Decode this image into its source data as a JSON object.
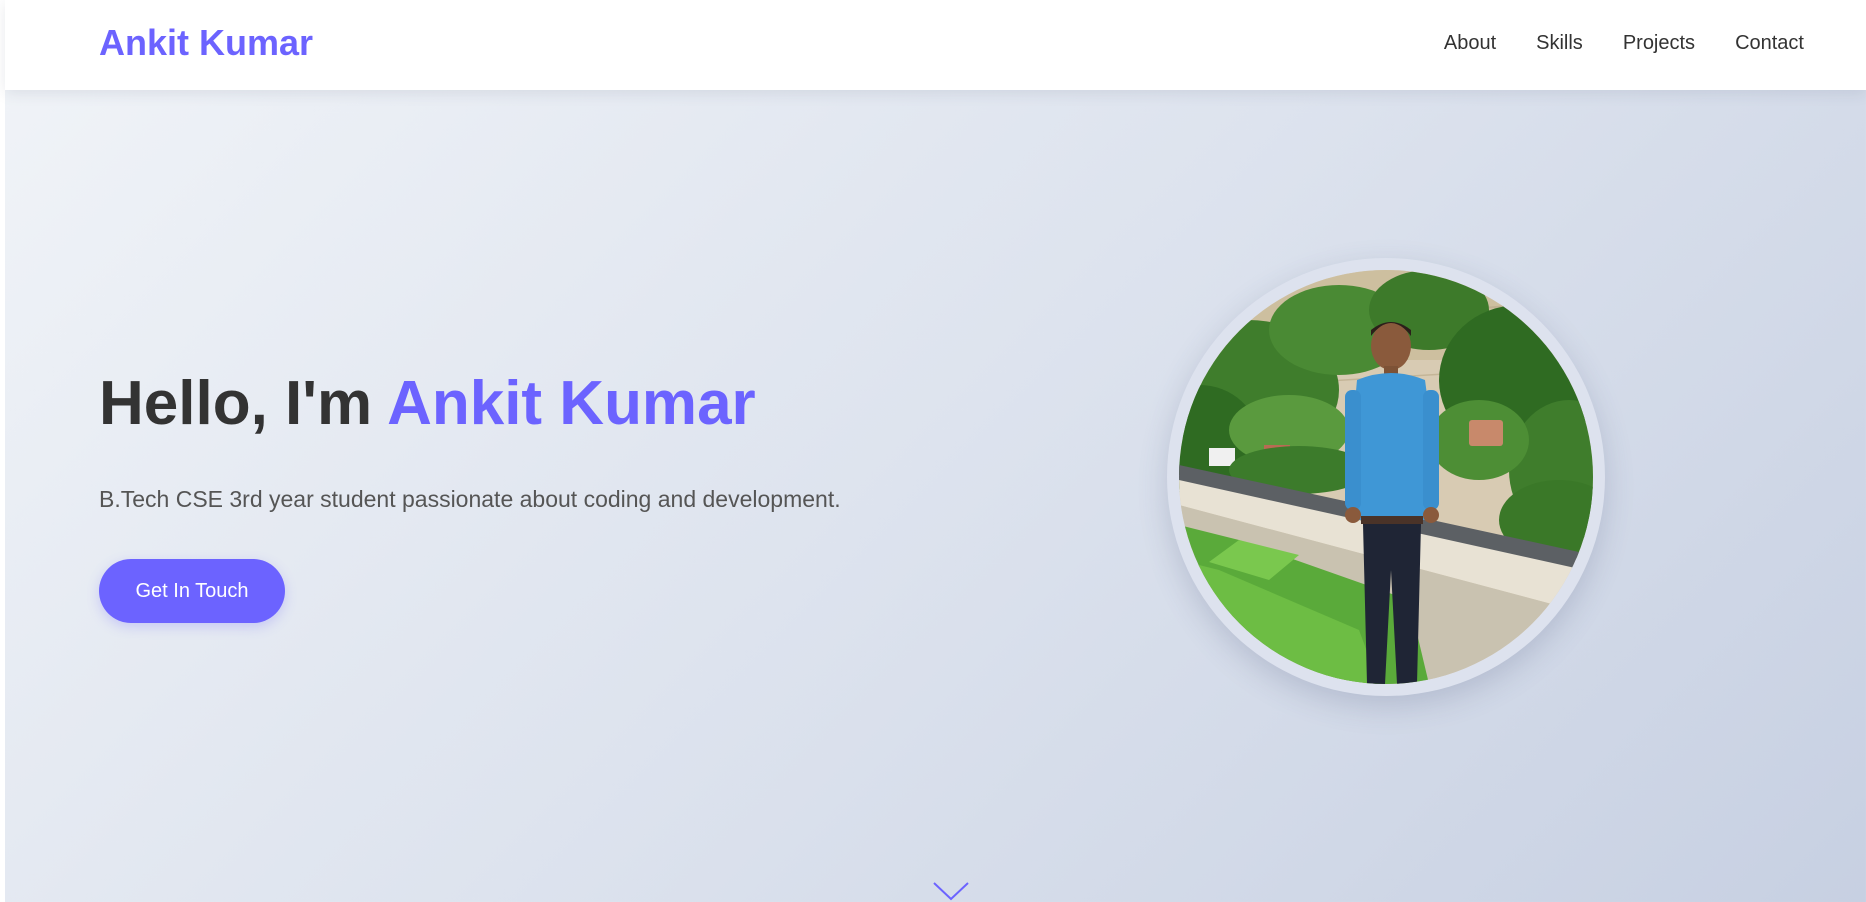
{
  "header": {
    "logo": "Ankit Kumar",
    "nav": [
      {
        "label": "About"
      },
      {
        "label": "Skills"
      },
      {
        "label": "Projects"
      },
      {
        "label": "Contact"
      }
    ]
  },
  "hero": {
    "greeting": "Hello, I'm ",
    "name": "Ankit Kumar",
    "subtitle": "B.Tech CSE 3rd year student passionate about coding and development.",
    "cta_label": "Get In Touch"
  },
  "icons": {
    "scroll": "chevron-down-icon"
  },
  "colors": {
    "accent": "#6c63ff",
    "text_dark": "#333333",
    "text_muted": "#555555"
  }
}
